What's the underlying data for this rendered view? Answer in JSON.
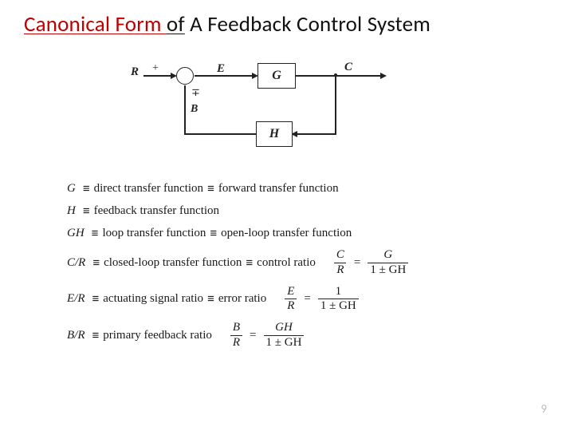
{
  "title": {
    "part1_red_underline": "Canonical Form ",
    "part2_black_underline": "of",
    "part3_black": " A Feedback Control System"
  },
  "page_number": "9",
  "diagram": {
    "signal_R": "R",
    "signal_E": "E",
    "signal_C": "C",
    "signal_B": "B",
    "plus": "+",
    "minusplus": "∓",
    "block_G": "G",
    "block_H": "H"
  },
  "defs": {
    "eqv": "≡",
    "row1": {
      "sym": "G",
      "text1": "direct transfer function",
      "text2": "forward transfer function"
    },
    "row2": {
      "sym": "H",
      "text1": "feedback transfer function"
    },
    "row3": {
      "sym": "GH",
      "text1": "loop transfer function",
      "text2": "open-loop transfer function"
    },
    "row4": {
      "sym": "C/R",
      "text1": "closed-loop transfer function",
      "text2": "control ratio",
      "lhs_num": "C",
      "lhs_den": "R",
      "rhs_num": "G",
      "rhs_den": "1 ± GH",
      "equals": "="
    },
    "row5": {
      "sym": "E/R",
      "text1": "actuating signal ratio",
      "text2": "error ratio",
      "lhs_num": "E",
      "lhs_den": "R",
      "rhs_num": "1",
      "rhs_den": "1 ± GH",
      "equals": "="
    },
    "row6": {
      "sym": "B/R",
      "text1": "primary feedback ratio",
      "lhs_num": "B",
      "lhs_den": "R",
      "rhs_num": "GH",
      "rhs_den": "1 ± GH",
      "equals": "="
    }
  }
}
